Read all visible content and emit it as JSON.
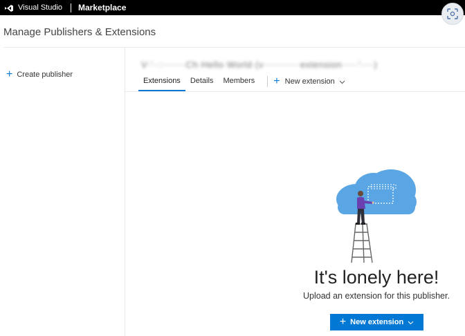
{
  "topbar": {
    "brand": "Visual Studio",
    "section": "Marketplace"
  },
  "page": {
    "title": "Manage Publishers & Extensions"
  },
  "sidebar": {
    "create_publisher_label": "Create publisher"
  },
  "publisher": {
    "name_obscured": "V·'··:·······Ch·Hello·World·(v···········extension·····'····)"
  },
  "tabs": [
    {
      "label": "Extensions",
      "active": true
    },
    {
      "label": "Details",
      "active": false
    },
    {
      "label": "Members",
      "active": false
    }
  ],
  "tab_action": {
    "label": "New extension"
  },
  "empty_state": {
    "title": "It's lonely here!",
    "subtitle": "Upload an extension for this publisher.",
    "button_label": "New extension"
  },
  "colors": {
    "accent": "#0078d4",
    "topbar": "#000000",
    "cloud": "#5aa5e3"
  },
  "icons": {
    "vs_logo": "visual-studio-logo-icon",
    "plus": "plus-icon",
    "chevron": "chevron-down-icon",
    "corner": "screen-capture-icon"
  }
}
